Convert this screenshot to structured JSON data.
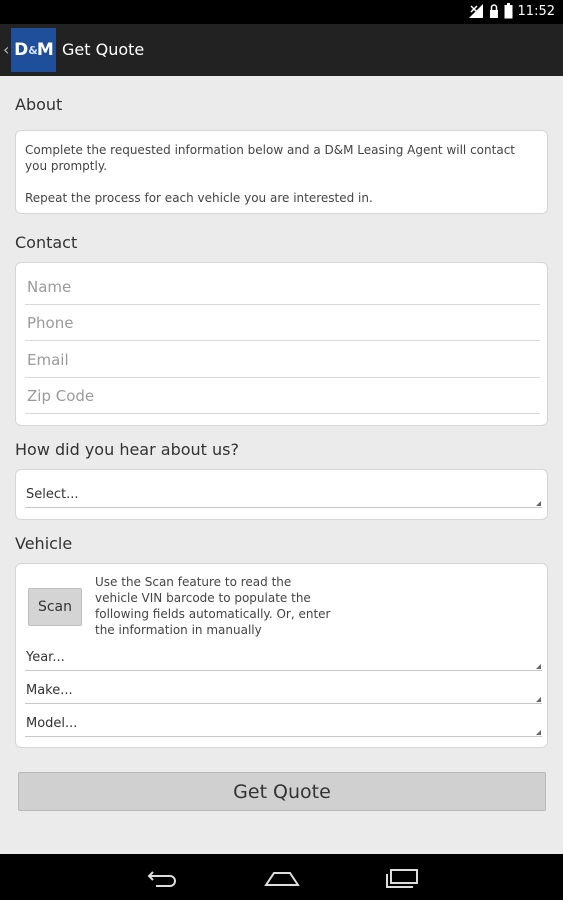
{
  "status_bar": {
    "time": "11:52"
  },
  "action_bar": {
    "logo_text_left": "D",
    "logo_amp": "&",
    "logo_text_right": "M",
    "title": "Get Quote"
  },
  "about": {
    "title": "About",
    "paragraph1": "Complete the requested information below and a D&M Leasing Agent will contact you promptly.",
    "paragraph2": "Repeat the process for each vehicle you are interested in."
  },
  "contact": {
    "title": "Contact",
    "name_placeholder": "Name",
    "phone_placeholder": "Phone",
    "email_placeholder": "Email",
    "zip_placeholder": "Zip Code"
  },
  "referral": {
    "title": "How did you hear about us?",
    "select_value": "Select..."
  },
  "vehicle": {
    "title": "Vehicle",
    "scan_label": "Scan",
    "scan_instructions": "Use the Scan feature to read the vehicle VIN barcode to populate the following fields automatically. Or, enter the information in manually",
    "year_value": "Year...",
    "make_value": "Make...",
    "model_value": "Model..."
  },
  "submit_label": "Get Quote",
  "icons": {
    "status": [
      "signal-icon",
      "lock-icon",
      "battery-icon"
    ],
    "nav": [
      "back-icon",
      "home-icon",
      "recent-apps-icon"
    ]
  }
}
